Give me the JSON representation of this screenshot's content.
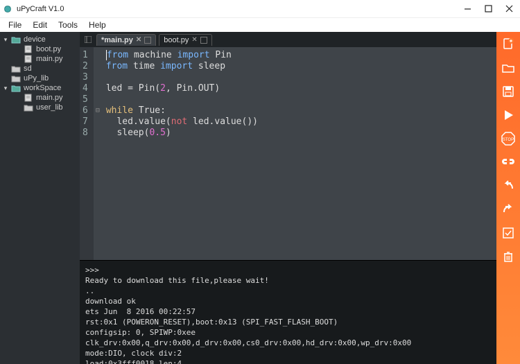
{
  "window": {
    "title": "uPyCraft V1.0"
  },
  "menu": [
    "File",
    "Edit",
    "Tools",
    "Help"
  ],
  "tree": [
    {
      "type": "folder-open",
      "label": "device",
      "level": 1,
      "arrow": "▾"
    },
    {
      "type": "file",
      "label": "boot.py",
      "level": 2
    },
    {
      "type": "file",
      "label": "main.py",
      "level": 2
    },
    {
      "type": "folder",
      "label": "sd",
      "level": 1,
      "arrow": ""
    },
    {
      "type": "folder",
      "label": "uPy_lib",
      "level": 1,
      "arrow": ""
    },
    {
      "type": "folder-open",
      "label": "workSpace",
      "level": 1,
      "arrow": "▾"
    },
    {
      "type": "file",
      "label": "main.py",
      "level": 2
    },
    {
      "type": "folder",
      "label": "user_lib",
      "level": 2
    }
  ],
  "tabs": [
    {
      "label": "*main.py",
      "active": true
    },
    {
      "label": "boot.py",
      "active": false
    }
  ],
  "code": {
    "lines": [
      {
        "n": 1,
        "html": "<span class='kw-import'>from</span> machine <span class='kw-import'>import</span> Pin"
      },
      {
        "n": 2,
        "html": "<span class='kw-import'>from</span> time <span class='kw-import'>import</span> sleep"
      },
      {
        "n": 3,
        "html": ""
      },
      {
        "n": 4,
        "html": "led = Pin(<span class='num'>2</span>, Pin.OUT)"
      },
      {
        "n": 5,
        "html": ""
      },
      {
        "n": 6,
        "html": "<span class='kw-ctrl'>while</span> True:",
        "fold": "⊟"
      },
      {
        "n": 7,
        "html": "  led.value(<span class='kw-op'>not</span> led.value())"
      },
      {
        "n": 8,
        "html": "  sleep(<span class='num'>0.5</span>)"
      }
    ]
  },
  "console": [
    ">>>",
    "",
    "Ready to download this file,please wait!",
    "..",
    "download ok",
    "ets Jun  8 2016 00:22:57",
    "",
    "rst:0x1 (POWERON_RESET),boot:0x13 (SPI_FAST_FLASH_BOOT)",
    "configsip: 0, SPIWP:0xee",
    "clk_drv:0x00,q_drv:0x00,d_drv:0x00,cs0_drv:0x00,hd_drv:0x00,wp_drv:0x00",
    "mode:DIO, clock div:2",
    "load:0x3fff0018,len:4"
  ],
  "toolbar": [
    "new-file",
    "open-file",
    "save-file",
    "run",
    "stop",
    "connect",
    "undo",
    "redo",
    "tools",
    "delete"
  ]
}
